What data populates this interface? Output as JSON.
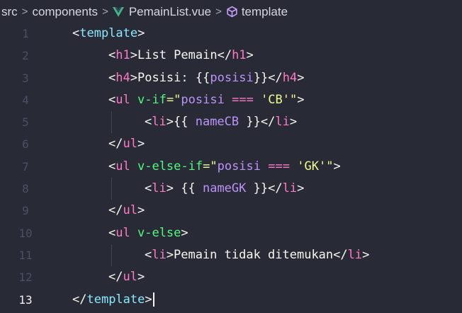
{
  "breadcrumb": {
    "items": [
      {
        "label": "src",
        "icon": ""
      },
      {
        "label": "components",
        "icon": ""
      },
      {
        "label": "PemainList.vue",
        "icon": "vue-icon"
      },
      {
        "label": "template",
        "icon": "cube-icon"
      }
    ],
    "separator": ">"
  },
  "colors": {
    "background": "#282a36",
    "tag": "#ff79c6",
    "template_tag": "#8be9fd",
    "attribute": "#50fa7b",
    "string": "#f1fa8c",
    "variable": "#bd93f9",
    "text": "#f8f8f2",
    "line_number": "#4a4f66",
    "line_number_active": "#f0f1f5"
  },
  "editor": {
    "active_line": 13,
    "lines": [
      {
        "num": "1",
        "indent": 0,
        "tokens": [
          {
            "t": "<",
            "c": "bracket"
          },
          {
            "t": "template",
            "c": "tmpl"
          },
          {
            "t": ">",
            "c": "bracket"
          }
        ]
      },
      {
        "num": "2",
        "indent": 1,
        "tokens": [
          {
            "t": "<",
            "c": "bracket"
          },
          {
            "t": "h1",
            "c": "tag"
          },
          {
            "t": ">",
            "c": "bracket"
          },
          {
            "t": "List Pemain",
            "c": "text"
          },
          {
            "t": "</",
            "c": "bracket"
          },
          {
            "t": "h1",
            "c": "tag"
          },
          {
            "t": ">",
            "c": "bracket"
          }
        ]
      },
      {
        "num": "3",
        "indent": 1,
        "tokens": [
          {
            "t": "<",
            "c": "bracket"
          },
          {
            "t": "h4",
            "c": "tag"
          },
          {
            "t": ">",
            "c": "bracket"
          },
          {
            "t": "Posisi: ",
            "c": "text"
          },
          {
            "t": "{{",
            "c": "mus"
          },
          {
            "t": "posisi",
            "c": "var"
          },
          {
            "t": "}}",
            "c": "mus"
          },
          {
            "t": "</",
            "c": "bracket"
          },
          {
            "t": "h4",
            "c": "tag"
          },
          {
            "t": ">",
            "c": "bracket"
          }
        ]
      },
      {
        "num": "4",
        "indent": 1,
        "tokens": [
          {
            "t": "<",
            "c": "bracket"
          },
          {
            "t": "ul",
            "c": "tag"
          },
          {
            "t": " ",
            "c": "text"
          },
          {
            "t": "v-if",
            "c": "attr"
          },
          {
            "t": "=\"",
            "c": "str"
          },
          {
            "t": "posisi",
            "c": "var"
          },
          {
            "t": " ",
            "c": "text"
          },
          {
            "t": "===",
            "c": "op"
          },
          {
            "t": " ",
            "c": "text"
          },
          {
            "t": "'CB'",
            "c": "str"
          },
          {
            "t": "\"",
            "c": "str"
          },
          {
            "t": ">",
            "c": "bracket"
          }
        ]
      },
      {
        "num": "5",
        "indent": 2,
        "tokens": [
          {
            "t": "<",
            "c": "bracket"
          },
          {
            "t": "li",
            "c": "tag"
          },
          {
            "t": ">",
            "c": "bracket"
          },
          {
            "t": "{{",
            "c": "mus"
          },
          {
            "t": " ",
            "c": "text"
          },
          {
            "t": "nameCB",
            "c": "var"
          },
          {
            "t": " ",
            "c": "text"
          },
          {
            "t": "}}",
            "c": "mus"
          },
          {
            "t": "</",
            "c": "bracket"
          },
          {
            "t": "li",
            "c": "tag"
          },
          {
            "t": ">",
            "c": "bracket"
          }
        ]
      },
      {
        "num": "6",
        "indent": 1,
        "tokens": [
          {
            "t": "</",
            "c": "bracket"
          },
          {
            "t": "ul",
            "c": "tag"
          },
          {
            "t": ">",
            "c": "bracket"
          }
        ]
      },
      {
        "num": "7",
        "indent": 1,
        "tokens": [
          {
            "t": "<",
            "c": "bracket"
          },
          {
            "t": "ul",
            "c": "tag"
          },
          {
            "t": " ",
            "c": "text"
          },
          {
            "t": "v-else-if",
            "c": "attr"
          },
          {
            "t": "=\"",
            "c": "str"
          },
          {
            "t": "posisi",
            "c": "var"
          },
          {
            "t": " ",
            "c": "text"
          },
          {
            "t": "===",
            "c": "op"
          },
          {
            "t": " ",
            "c": "text"
          },
          {
            "t": "'GK'",
            "c": "str"
          },
          {
            "t": "\"",
            "c": "str"
          },
          {
            "t": ">",
            "c": "bracket"
          }
        ]
      },
      {
        "num": "8",
        "indent": 2,
        "tokens": [
          {
            "t": "<",
            "c": "bracket"
          },
          {
            "t": "li",
            "c": "tag"
          },
          {
            "t": ">",
            "c": "bracket"
          },
          {
            "t": " ",
            "c": "text"
          },
          {
            "t": "{{",
            "c": "mus"
          },
          {
            "t": " ",
            "c": "text"
          },
          {
            "t": "nameGK",
            "c": "var"
          },
          {
            "t": " ",
            "c": "text"
          },
          {
            "t": "}}",
            "c": "mus"
          },
          {
            "t": "</",
            "c": "bracket"
          },
          {
            "t": "li",
            "c": "tag"
          },
          {
            "t": ">",
            "c": "bracket"
          }
        ]
      },
      {
        "num": "9",
        "indent": 1,
        "tokens": [
          {
            "t": "</",
            "c": "bracket"
          },
          {
            "t": "ul",
            "c": "tag"
          },
          {
            "t": ">",
            "c": "bracket"
          }
        ]
      },
      {
        "num": "10",
        "indent": 1,
        "tokens": [
          {
            "t": "<",
            "c": "bracket"
          },
          {
            "t": "ul",
            "c": "tag"
          },
          {
            "t": " ",
            "c": "text"
          },
          {
            "t": "v-else",
            "c": "attr"
          },
          {
            "t": ">",
            "c": "bracket"
          }
        ]
      },
      {
        "num": "11",
        "indent": 2,
        "tokens": [
          {
            "t": "<",
            "c": "bracket"
          },
          {
            "t": "li",
            "c": "tag"
          },
          {
            "t": ">",
            "c": "bracket"
          },
          {
            "t": "Pemain tidak ditemukan",
            "c": "text"
          },
          {
            "t": "</",
            "c": "bracket"
          },
          {
            "t": "li",
            "c": "tag"
          },
          {
            "t": ">",
            "c": "bracket"
          }
        ]
      },
      {
        "num": "12",
        "indent": 1,
        "tokens": [
          {
            "t": "</",
            "c": "bracket"
          },
          {
            "t": "ul",
            "c": "tag"
          },
          {
            "t": ">",
            "c": "bracket"
          }
        ]
      },
      {
        "num": "13",
        "indent": 0,
        "tokens": [
          {
            "t": "</",
            "c": "bracket"
          },
          {
            "t": "template",
            "c": "tmpl"
          },
          {
            "t": ">",
            "c": "bracket"
          }
        ]
      }
    ]
  }
}
